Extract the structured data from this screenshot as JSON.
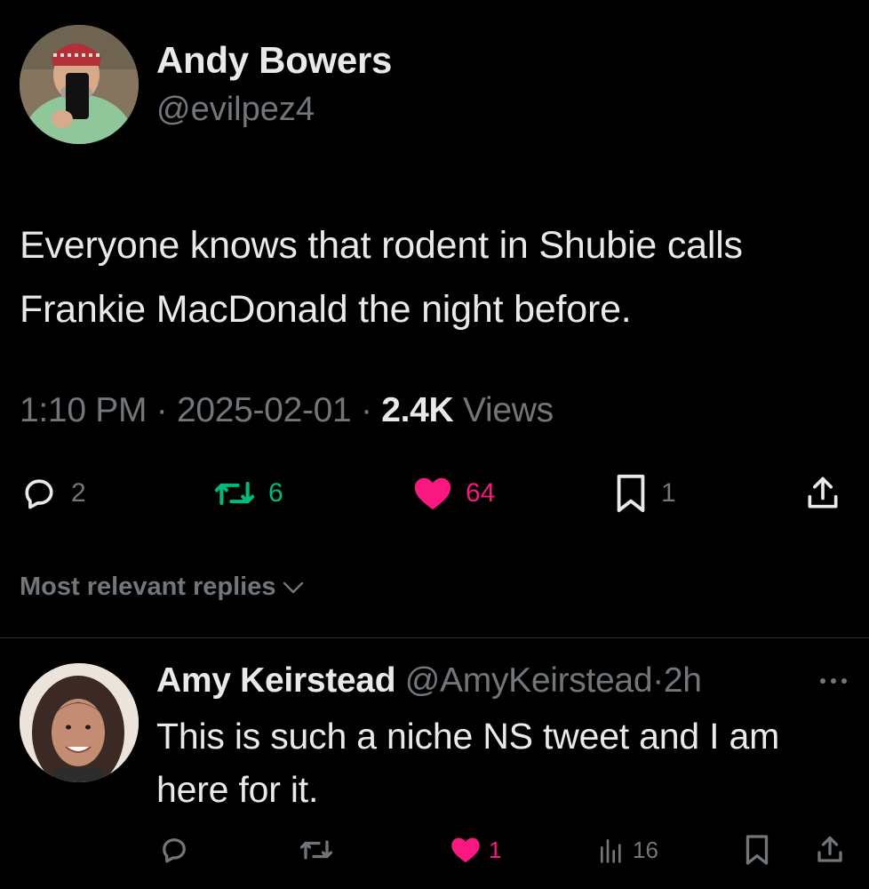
{
  "tweet": {
    "author_name": "Andy Bowers",
    "author_handle": "@evilpez4",
    "text": "Everyone knows that rodent in Shubie calls Frankie MacDonald the night before.",
    "time": "1:10 PM",
    "separator": "·",
    "date": "2025-02-01",
    "views_count": "2.4K",
    "views_label": "Views",
    "stats": {
      "replies": "2",
      "retweets": "6",
      "likes": "64",
      "bookmarks": "1"
    }
  },
  "replies_sort": {
    "label": "Most relevant replies"
  },
  "reply": {
    "author_name": "Amy Keirstead",
    "author_handle": "@AmyKeirstead",
    "separator": "·",
    "time_ago": "2h",
    "text": "This is such a niche NS tweet and I am here for it.",
    "stats": {
      "likes": "1",
      "views": "16"
    }
  },
  "colors": {
    "background": "#000000",
    "text_primary": "#e7e9ea",
    "text_secondary": "#71767b",
    "retweet_green": "#00ba7c",
    "like_pink": "#f91880",
    "divider": "#2f3336"
  },
  "icons": [
    "reply-icon",
    "retweet-icon",
    "heart-icon",
    "bookmark-icon",
    "share-icon",
    "chevron-down-icon",
    "more-icon",
    "views-icon"
  ]
}
